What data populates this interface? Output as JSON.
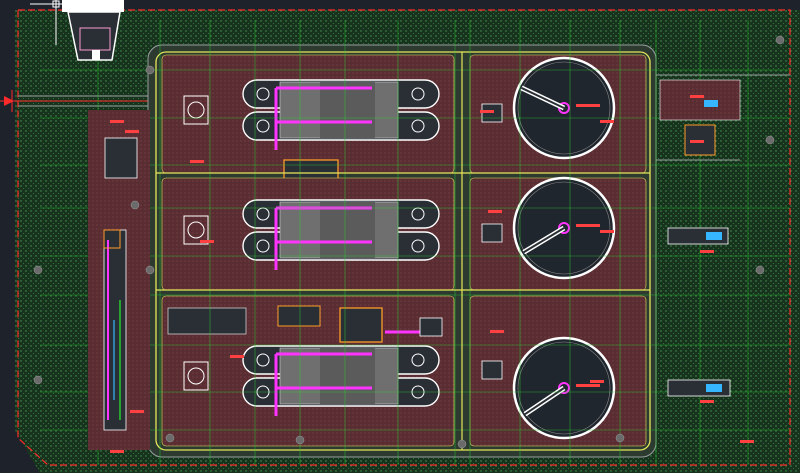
{
  "drawing": {
    "background_color": "#1e232b",
    "site_fill_color": "#17331d",
    "basin_fill_color": "#5a2d32",
    "aisle_fill_color": "#3f3a3c",
    "boundary_color": "#ff2a2a",
    "road_color": "#e6e65a",
    "pipe_color": "#ff33ff",
    "grid_line_color": "#29d42e",
    "clarifier_fill_color": "#20262d",
    "clarifier_ring_color": "#ffffff",
    "tank_fill_color": "#6f6f6f",
    "building_fill_color": "#2a2f36",
    "annotation_color": "#ff4040",
    "building_outline_color": "#ff9b2a",
    "process_trains": 3,
    "icons": {
      "north_marker": "crosshair-icon",
      "inlet_marker": "triangle-arrow-icon"
    }
  }
}
